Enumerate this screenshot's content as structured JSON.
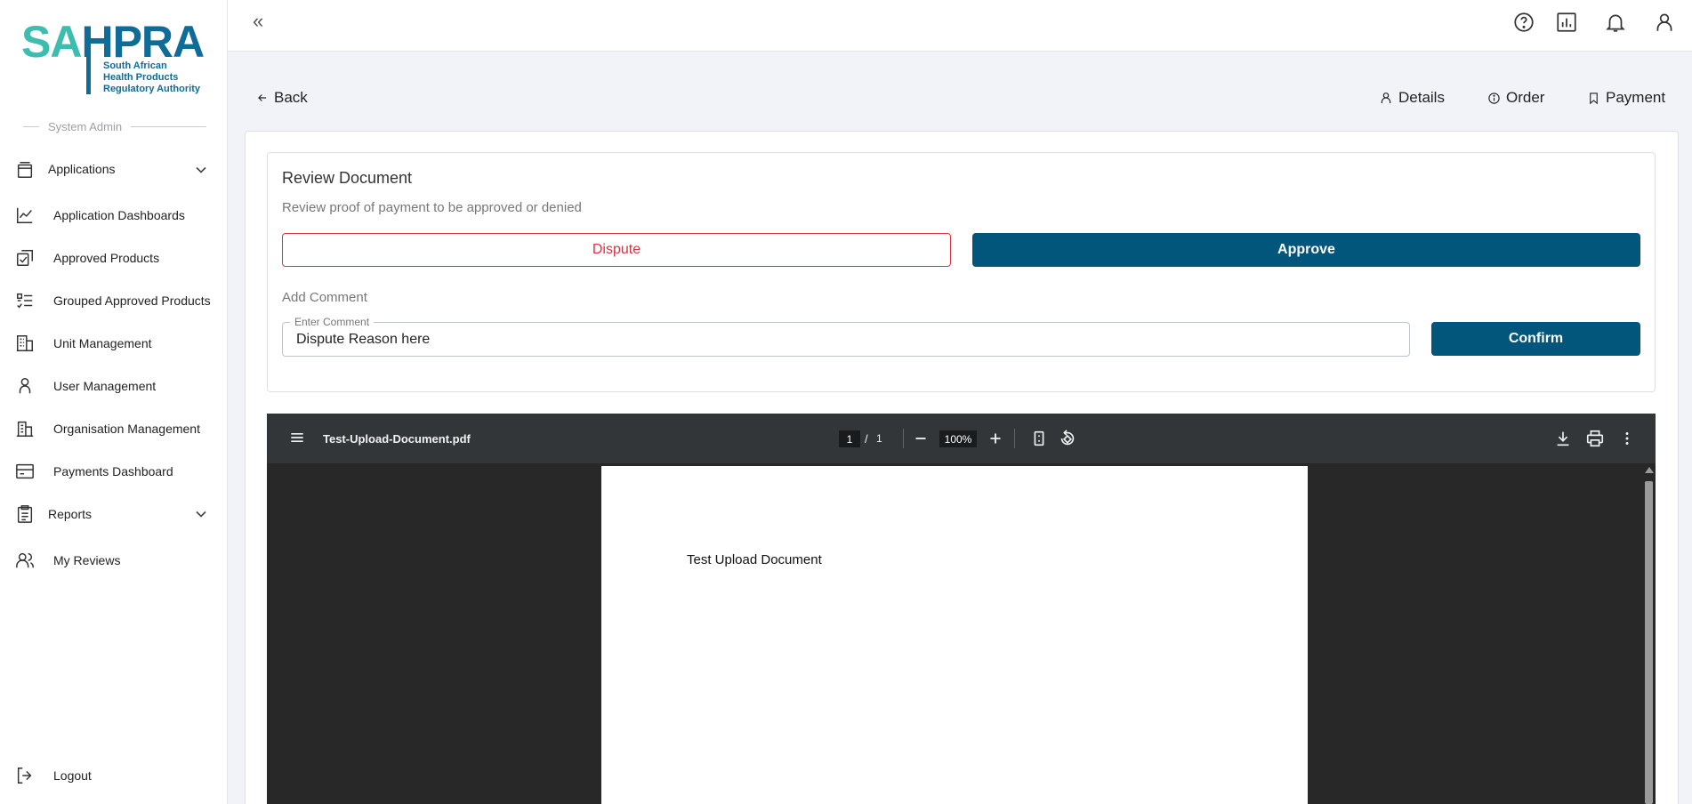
{
  "brand": {
    "logo_sa": "SA",
    "logo_hpra": "HPRA",
    "logo_subtitle_1": "South African",
    "logo_subtitle_2": "Health Products",
    "logo_subtitle_3": "Regulatory Authority",
    "color_teal": "#3dbcb0",
    "color_blue": "#0f6b97"
  },
  "sidebar": {
    "role": "System Admin",
    "items": [
      {
        "label": "Applications",
        "icon": "stack-icon",
        "expandable": true
      },
      {
        "label": "Application Dashboards",
        "icon": "line-chart-icon"
      },
      {
        "label": "Approved Products",
        "icon": "checked-docs-icon"
      },
      {
        "label": "Grouped Approved Products",
        "icon": "checklist-icon"
      },
      {
        "label": "Unit Management",
        "icon": "building-icon"
      },
      {
        "label": "User Management",
        "icon": "user-icon"
      },
      {
        "label": "Organisation Management",
        "icon": "organisation-icon"
      },
      {
        "label": "Payments Dashboard",
        "icon": "card-icon"
      },
      {
        "label": "Reports",
        "icon": "clipboard-icon",
        "expandable": true
      },
      {
        "label": "My Reviews",
        "icon": "users-icon"
      }
    ],
    "logout": "Logout"
  },
  "topbar": {
    "collapse": "«",
    "icons": [
      "help-icon",
      "report-icon",
      "bell-icon",
      "profile-icon"
    ]
  },
  "subheader": {
    "back": "Back",
    "tabs": [
      "Details",
      "Order",
      "Payment"
    ]
  },
  "review": {
    "title": "Review Document",
    "subtitle": "Review proof of payment to be approved or denied",
    "dispute": "Dispute",
    "approve": "Approve",
    "add_comment": "Add Comment",
    "comment_label": "Enter Comment",
    "comment_value": "Dispute Reason here",
    "confirm": "Confirm",
    "primary_color": "#02557b",
    "danger_color": "#d9333f"
  },
  "pdf": {
    "filename": "Test-Upload-Document.pdf",
    "page": "1",
    "page_sep": "/",
    "total_pages": "1",
    "zoom": "100%",
    "content_text": "Test Upload Document"
  }
}
